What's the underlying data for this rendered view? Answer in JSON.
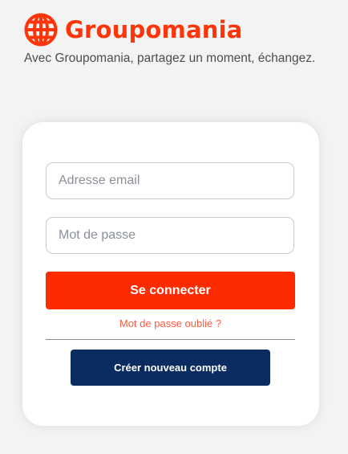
{
  "brand": {
    "name": "Groupomania",
    "tagline": "Avec Groupomania, partagez un moment, échangez.",
    "logo_icon": "globe-icon",
    "accent_color": "#ff3409"
  },
  "login_form": {
    "email_placeholder": "Adresse email",
    "email_value": "",
    "password_placeholder": "Mot de passe",
    "password_value": "",
    "login_button_label": "Se connecter",
    "login_button_color": "#ff2b00",
    "forgot_password_label": "Mot de passe oublié ?",
    "forgot_password_color": "#fc5a3f",
    "create_account_label": "Créer nouveau compte",
    "create_account_color": "#0b2c61"
  }
}
